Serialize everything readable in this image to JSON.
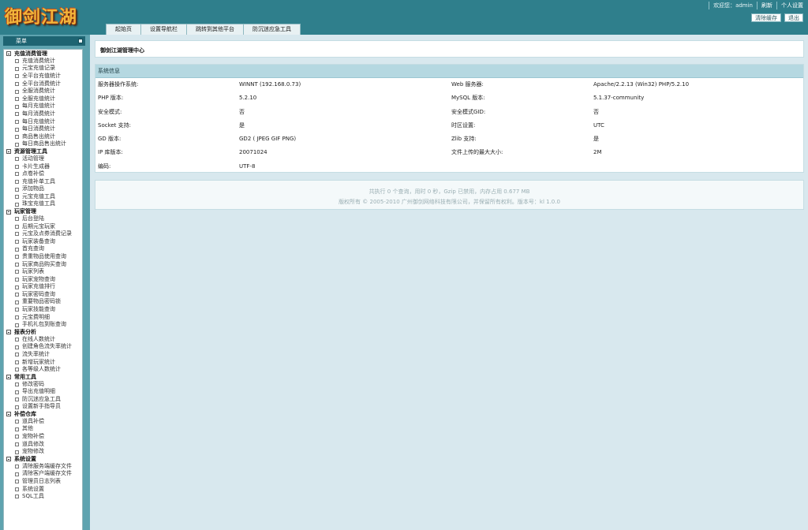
{
  "header": {
    "logo_text": "御剑江湖",
    "welcome_prefix": "欢迎您：",
    "username": "admin",
    "refresh_label": "刷新",
    "settings_label": "个人设置",
    "clear_cache_label": "清除缓存",
    "logout_label": "退出"
  },
  "nav": {
    "tabs": [
      {
        "label": "起始页"
      },
      {
        "label": "设置导航栏"
      },
      {
        "label": "跳转到其他平台"
      },
      {
        "label": "防沉迷应急工具"
      }
    ]
  },
  "sidebar": {
    "title": "菜单",
    "groups": [
      {
        "title": "充值消费管理",
        "items": [
          "充值消费统计",
          "元宝充值记录",
          "全平台充值统计",
          "全平台消费统计",
          "全服消费统计",
          "全服充值统计",
          "每月充值统计",
          "每月消费统计",
          "每日充值统计",
          "每日消费统计",
          "商品售出统计",
          "每日商品售出统计"
        ]
      },
      {
        "title": "资源管理工具",
        "items": [
          "活动管理",
          "卡片生成器",
          "点卷补偿",
          "充值补单工具",
          "添加物品",
          "元宝充值工具",
          "珠宝充值工具"
        ]
      },
      {
        "title": "玩家管理",
        "items": [
          "后台登陆",
          "后期元宝玩家",
          "元宝及点券消费记录",
          "玩家装备查询",
          "首充查询",
          "贵重物品使用查询",
          "玩家商品购买查询",
          "玩家列表",
          "玩家宠物查询",
          "玩家充值排行",
          "玩家密码查询",
          "重要物品密码锁",
          "玩家技能查询",
          "元宝费明细",
          "手机礼包到账查询"
        ]
      },
      {
        "title": "报表分析",
        "items": [
          "在线人数统计",
          "创建角色流失率统计",
          "流失率统计",
          "新增玩家统计",
          "各等级人数统计"
        ]
      },
      {
        "title": "常用工具",
        "items": [
          "修改密码",
          "导出充值明细",
          "防沉迷应急工具",
          "设置新手指导员"
        ]
      },
      {
        "title": "补偿仓库",
        "items": [
          "道具补偿",
          "其他",
          "宠物补偿",
          "道具修改",
          "宠物修改"
        ]
      },
      {
        "title": "系统设置",
        "items": [
          "清除服务端缓存文件",
          "清除客户端缓存文件",
          "管理员日志列表",
          "系统设置",
          "SQL工具"
        ]
      }
    ]
  },
  "main": {
    "title": "御剑江湖管理中心",
    "sysinfo_title": "系统信息",
    "rows": [
      {
        "k1": "服务器操作系统:",
        "v1": "WINNT (192.168.0.73)",
        "k2": "Web 服务器:",
        "v2": "Apache/2.2.13 (Win32) PHP/5.2.10"
      },
      {
        "k1": "PHP 版本:",
        "v1": "5.2.10",
        "k2": "MySQL 版本:",
        "v2": "5.1.37-community"
      },
      {
        "k1": "安全模式:",
        "v1": "否",
        "k2": "安全模式GID:",
        "v2": "否"
      },
      {
        "k1": "Socket 支持:",
        "v1": "是",
        "k2": "时区设置:",
        "v2": "UTC"
      },
      {
        "k1": "GD 版本:",
        "v1": "GD2 ( JPEG GIF PNG)",
        "k2": "Zlib 支持:",
        "v2": "是"
      },
      {
        "k1": "IP 库版本:",
        "v1": "20071024",
        "k2": "文件上传的最大大小:",
        "v2": "2M"
      },
      {
        "k1": "编码:",
        "v1": "UTF-8",
        "k2": "",
        "v2": ""
      }
    ],
    "footer_line1": "共执行 0 个查询，用时 0 秒，Gzip 已禁用，内存占用 0.677 MB",
    "footer_line2": "版权所有 © 2005-2010 广州御剑网络科技有限公司，并保留所有权利。版本号：kl 1.0.0"
  }
}
